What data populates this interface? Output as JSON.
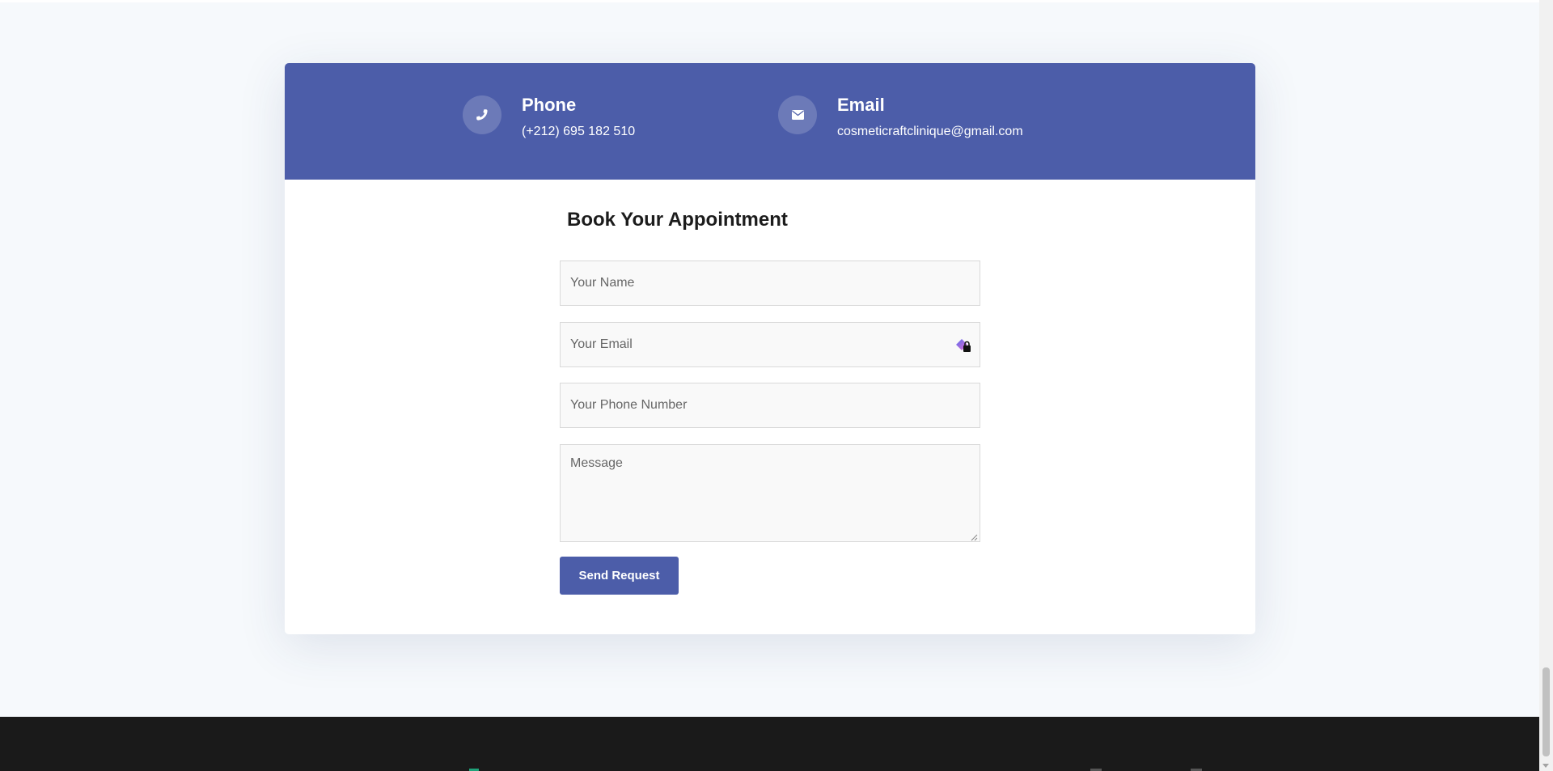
{
  "contact": {
    "phone": {
      "title": "Phone",
      "value": "(+212) 695 182 510",
      "icon": "phone-icon"
    },
    "email": {
      "title": "Email",
      "value": "cosmeticraftclinique@gmail.com",
      "icon": "envelope-icon"
    }
  },
  "form": {
    "title": "Book Your Appointment",
    "name_placeholder": "Your Name",
    "email_placeholder": "Your Email",
    "phone_placeholder": "Your Phone Number",
    "message_placeholder": "Message",
    "submit_label": "Send Request"
  },
  "colors": {
    "brand": "#4c5da9",
    "page_background": "#f6f9fc",
    "footer": "#1a1a1a"
  }
}
